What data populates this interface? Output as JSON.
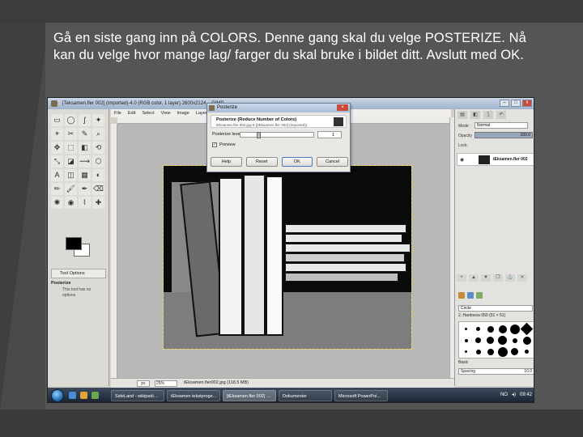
{
  "slide": {
    "instruction": "Gå en siste gang inn på COLORS. Denne gang skal du velge POSTERIZE. Nå kan du velge hvor mange lag/ farger du skal bruke i bildet ditt. Avslutt med OK."
  },
  "gimp_window": {
    "title": "[Teksamen.fler 002] (imported)-4.0 (RGB color, 1 layer) 2600x2124 – GIMP",
    "controls": [
      "–",
      "□",
      "x"
    ]
  },
  "image_menu": [
    "File",
    "Edit",
    "Select",
    "View",
    "Image",
    "Layer",
    "Colors",
    "Tools",
    "Filters",
    "Windows",
    "Help"
  ],
  "toolbox": {
    "tools": [
      "▭",
      "◯",
      "ʃ",
      "✦",
      "⌖",
      "✂",
      "✎",
      "⌕",
      "✥",
      "⬚",
      "◧",
      "⟲",
      "⤡",
      "◪",
      "⟿",
      "⬡",
      "A",
      "◫",
      "▦",
      "◐",
      "✏",
      "🖌",
      "✒",
      "⌫",
      "✺",
      "◉",
      "⌇",
      "✚"
    ],
    "options_tab": "Tool Options",
    "options_title": "Posterize",
    "options_message": "This tool has no options."
  },
  "status_bar": {
    "unit": "px",
    "zoom": "25%",
    "text": "tEksamen.fler002.jpg (118.5 MB)"
  },
  "posterize_dialog": {
    "title": "Posterize",
    "header_title": "Posterize (Reduce Number of Colors)",
    "header_subtitle": "tEksamen.fler 002.jpg-8 ([tEksamen.fler 002] (imported))",
    "levels_label": "Posterize levels:",
    "levels_value": "1",
    "preview_label": "Preview",
    "preview_checked": true,
    "buttons": {
      "help": "Help",
      "reset": "Reset",
      "ok": "OK",
      "cancel": "Cancel"
    }
  },
  "layers_dock": {
    "mode_label": "Mode:",
    "mode_value": "Normal",
    "opacity_label": "Opacity",
    "opacity_value": "100.0",
    "lock_label": "Lock:",
    "layer_name": "tEksamen.fler 002",
    "brush_filter": "Circle",
    "brush_name": "2. Hardness 050 (51 × 51)",
    "brush_basic": "Basic",
    "spacing_label": "Spacing",
    "spacing_value": "10.0"
  },
  "taskbar": {
    "items": [
      "SideLand - wikipedi…",
      "tEksamen tekstproge…",
      "[tEksamen.fler 002] …",
      "Dokumenter",
      "Microsoft PowerPoi…"
    ],
    "language": "NO",
    "time": "09:42"
  },
  "colors": {
    "slide_bg": "#4a4a4a",
    "foreground_color": "#000000",
    "background_color": "#ffffff",
    "selection_outline": "#f2d84a"
  }
}
